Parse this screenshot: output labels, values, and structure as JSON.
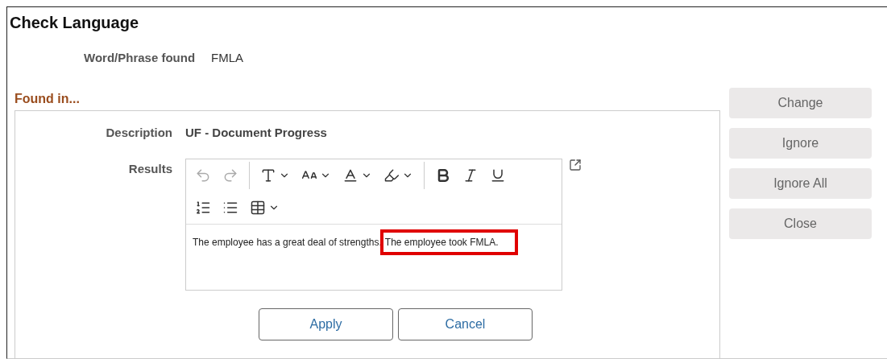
{
  "window": {
    "title": "Check Language"
  },
  "word_found": {
    "label": "Word/Phrase found",
    "value": "FMLA"
  },
  "section": {
    "title": "Found in..."
  },
  "description": {
    "label": "Description",
    "value": "UF - Document Progress"
  },
  "results": {
    "label": "Results",
    "toolbar": [
      [
        {
          "kind": "undo",
          "disabled": true
        },
        {
          "kind": "redo",
          "disabled": true
        },
        {
          "kind": "separator"
        },
        {
          "kind": "font",
          "dropdown": true
        },
        {
          "kind": "size",
          "dropdown": true
        },
        {
          "kind": "color",
          "dropdown": true
        },
        {
          "kind": "highlight",
          "dropdown": true
        },
        {
          "kind": "separator"
        },
        {
          "kind": "bold"
        },
        {
          "kind": "italic"
        },
        {
          "kind": "underline"
        }
      ],
      [
        {
          "kind": "ordered-list"
        },
        {
          "kind": "bullet-list"
        },
        {
          "kind": "table",
          "dropdown": true
        }
      ]
    ],
    "segments": [
      {
        "text": "The employee has a great deal of strengths.",
        "highlighted": false
      },
      {
        "text": "The employee took FMLA.",
        "highlighted": true
      }
    ]
  },
  "dialog_buttons": [
    {
      "label": "Apply"
    },
    {
      "label": "Cancel"
    }
  ],
  "side_buttons": [
    {
      "label": "Change",
      "disabled": true
    },
    {
      "label": "Ignore",
      "disabled": true
    },
    {
      "label": "Ignore All",
      "disabled": true
    },
    {
      "label": "Close",
      "disabled": true
    }
  ]
}
